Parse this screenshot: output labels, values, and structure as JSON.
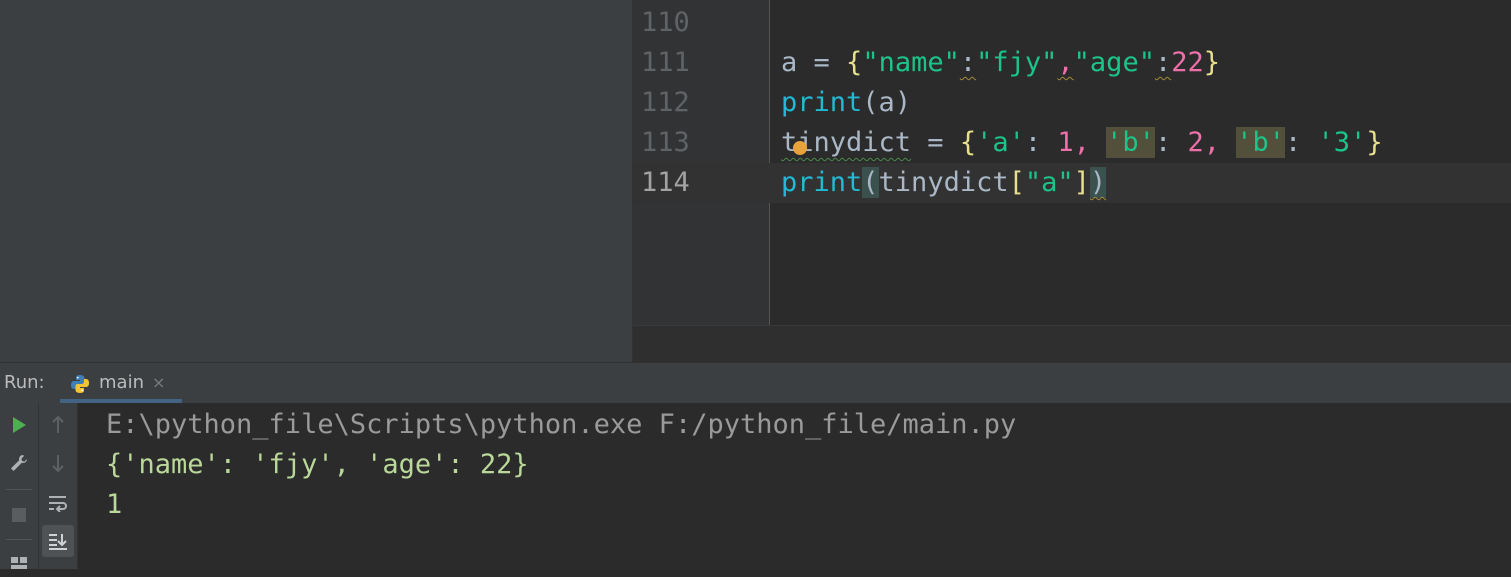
{
  "editor": {
    "lines": [
      {
        "num": "110"
      },
      {
        "num": "111"
      },
      {
        "num": "112"
      },
      {
        "num": "113"
      },
      {
        "num": "114"
      }
    ],
    "code": {
      "l111": {
        "a": "a",
        "eq": " = ",
        "ob": "{",
        "k1": "\"name\"",
        "c1": ":",
        "v1": "\"fjy\"",
        "cm": ",",
        "k2": "\"age\"",
        "c2": ":",
        "v2": "22",
        "cb": "}"
      },
      "l112": {
        "fn": "print",
        "op": "(",
        "arg": "a",
        "cp": ")"
      },
      "l113": {
        "name": "tinydict",
        "eq": " = ",
        "ob": "{",
        "k1": "'a'",
        "c1": ": ",
        "v1": "1",
        "s1": ", ",
        "k2": "'b'",
        "c2": ": ",
        "v2": "2",
        "s2": ", ",
        "k3": "'b'",
        "c3": ": ",
        "v3": "'3'",
        "cb": "}"
      },
      "l114": {
        "fn": "print",
        "op": "(",
        "arg": "tinydict",
        "obk": "[",
        "key": "\"a\"",
        "cbk": "]",
        "cp": ")"
      }
    }
  },
  "run": {
    "label": "Run:",
    "tab": "main",
    "close": "×"
  },
  "console": {
    "lines": [
      "E:\\python_file\\Scripts\\python.exe F:/python_file/main.py",
      "{'name': 'fjy', 'age': 22}",
      "1"
    ]
  },
  "colors": {
    "accent_run": "#4caf50",
    "string": "#1bc58a",
    "function": "#24b9d3",
    "number": "#ee6faa"
  }
}
